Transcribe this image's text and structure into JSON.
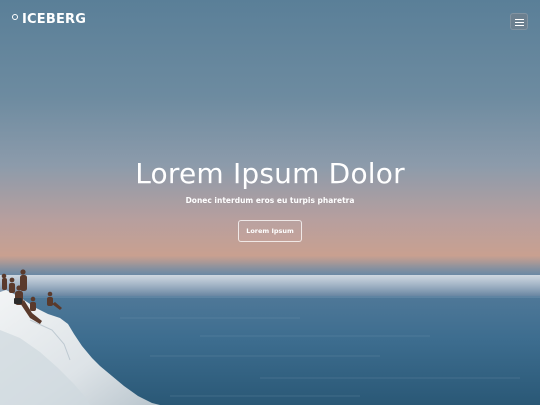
{
  "navbar": {
    "brand_name": "ICEBERG",
    "brand_icon": "circle-logo-icon",
    "menu_icon": "hamburger-menu-icon"
  },
  "hero": {
    "title": "Lorem Ipsum Dolor",
    "subtitle": "Donec interdum eros eu turpis pharetra",
    "cta_label": "Lorem Ipsum",
    "background": "sunset-sea-with-white-cliffs-photo"
  },
  "colors": {
    "sky_top": "#5a7f98",
    "horizon_glow": "#c9a090",
    "sea": "#36688a",
    "text": "#ffffff",
    "menu_button": "#6e808e"
  }
}
